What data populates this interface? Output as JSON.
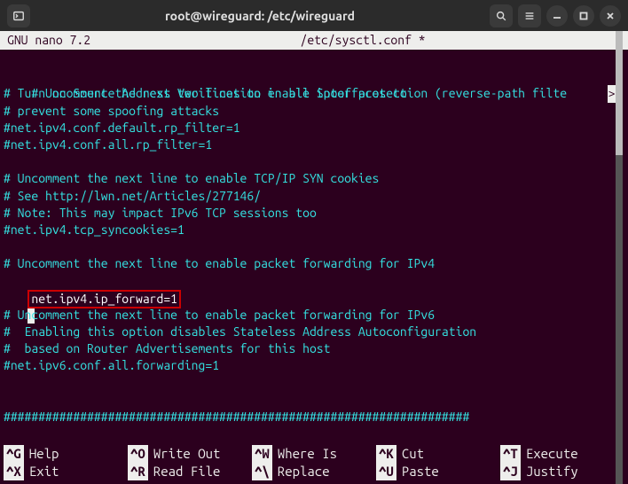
{
  "titlebar": {
    "title": "root@wireguard: /etc/wireguard"
  },
  "nano": {
    "editor_name": "GNU nano 7.2",
    "filename": "/etc/sysctl.conf *"
  },
  "file": {
    "l1": "# Uncomment the next two lines to enable Spoof protection (reverse-path filte",
    "l1_wrap": ">",
    "l2": "# Turn on Source Address Verification in all interfaces to",
    "l3": "# prevent some spoofing attacks",
    "l4": "#net.ipv4.conf.default.rp_filter=1",
    "l5": "#net.ipv4.conf.all.rp_filter=1",
    "l6": "# Uncomment the next line to enable TCP/IP SYN cookies",
    "l7": "# See http://lwn.net/Articles/277146/",
    "l8": "# Note: This may impact IPv6 TCP sessions too",
    "l9": "#net.ipv4.tcp_syncookies=1",
    "l10": "# Uncomment the next line to enable packet forwarding for IPv4",
    "l11": "net.ipv4.ip_forward=1",
    "l12": "# Uncomment the next line to enable packet forwarding for IPv6",
    "l13": "#  Enabling this option disables Stateless Address Autoconfiguration",
    "l14": "#  based on Router Advertisements for this host",
    "l15": "#net.ipv6.conf.all.forwarding=1",
    "l16": "###################################################################"
  },
  "shortcuts": {
    "r1": {
      "s1_k": "^G",
      "s1_l": "Help",
      "s2_k": "^O",
      "s2_l": "Write Out",
      "s3_k": "^W",
      "s3_l": "Where Is",
      "s4_k": "^K",
      "s4_l": "Cut",
      "s5_k": "^T",
      "s5_l": "Execute"
    },
    "r2": {
      "s1_k": "^X",
      "s1_l": "Exit",
      "s2_k": "^R",
      "s2_l": "Read File",
      "s3_k": "^\\",
      "s3_l": "Replace",
      "s4_k": "^U",
      "s4_l": "Paste",
      "s5_k": "^J",
      "s5_l": "Justify"
    }
  }
}
